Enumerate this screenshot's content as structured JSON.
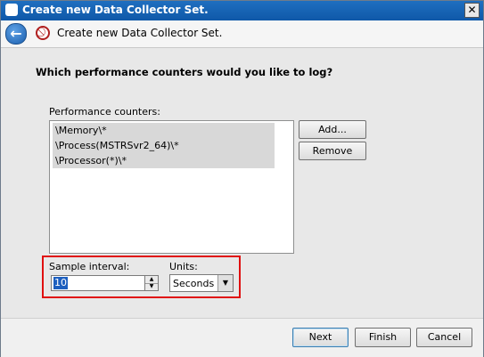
{
  "window": {
    "title": "Create new Data Collector Set.",
    "close_glyph": "✕"
  },
  "header": {
    "back_glyph": "←",
    "title": "Create new Data Collector Set."
  },
  "page": {
    "question": "Which performance counters would you like to log?",
    "counters_label": "Performance counters:",
    "counters": [
      "\\Memory\\*",
      "\\Process(MSTRSvr2_64)\\*",
      "\\Processor(*)\\*"
    ],
    "add_label": "Add...",
    "remove_label": "Remove",
    "sample_interval_label": "Sample interval:",
    "sample_interval_value": "10",
    "units_label": "Units:",
    "units_value": "Seconds"
  },
  "footer": {
    "next_label": "Next",
    "finish_label": "Finish",
    "cancel_label": "Cancel"
  },
  "colors": {
    "titlebar": "#0f58a8",
    "highlight_border": "#e01010",
    "selection": "#1d5fbf"
  },
  "icons": {
    "app": "data-collector-icon",
    "back": "back-arrow-icon",
    "step": "performance-monitor-icon"
  }
}
